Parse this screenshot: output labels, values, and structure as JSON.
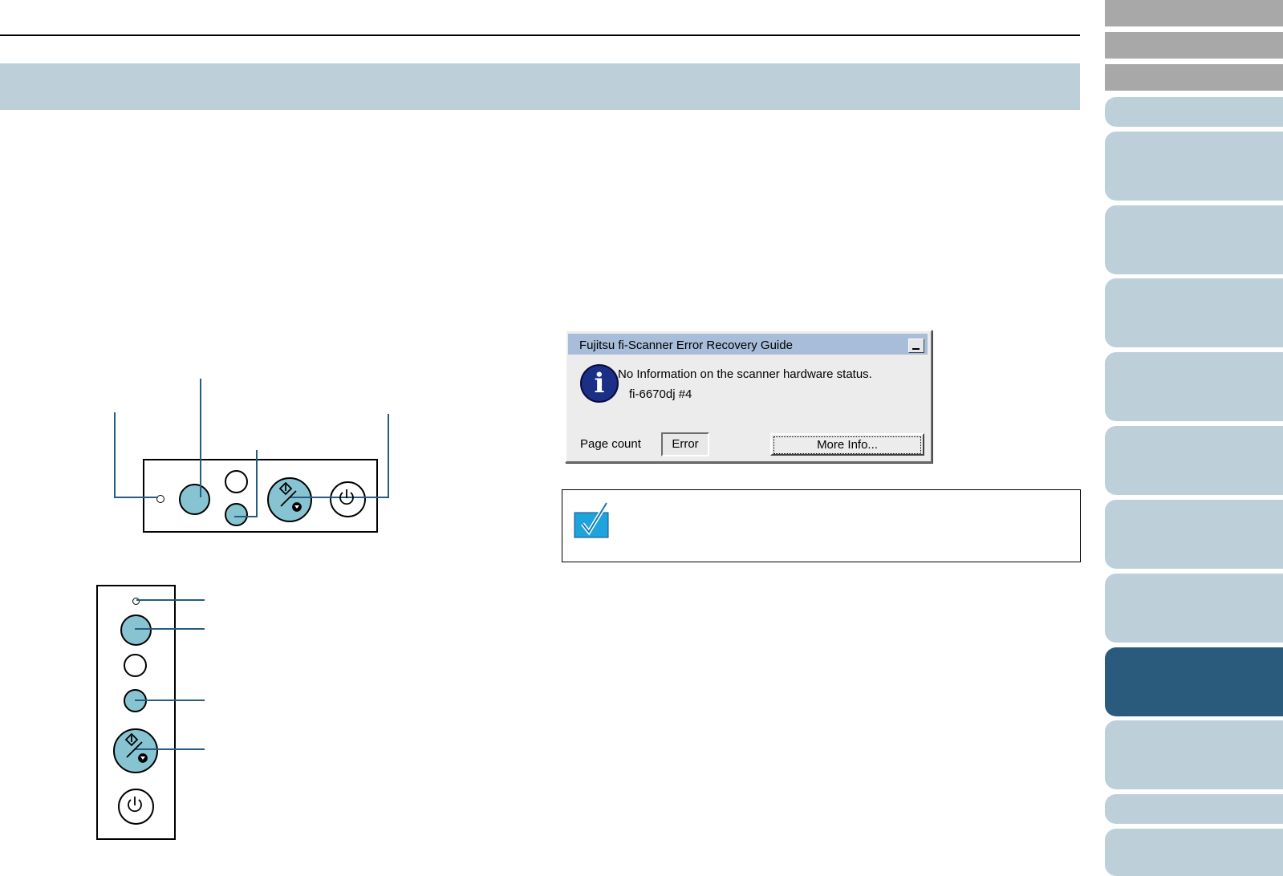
{
  "dialog": {
    "title": "Fujitsu fi-Scanner Error Recovery Guide",
    "info_icon": "info-icon",
    "message": "No Information on the scanner hardware status.",
    "device": "fi-6670dj #4",
    "page_count_label": "Page count",
    "page_count_value": "Error",
    "more_info_label": "More Info..."
  },
  "hint_icon": "checkmark-hint-icon",
  "colors": {
    "banner": "#bdd0da",
    "tab": "#bdd0da",
    "tab_active": "#2a5b7c",
    "tab_grey": "#a8a8a8",
    "button_blue": "#87c4d1",
    "callout_line": "#275b80"
  },
  "nav_tabs": {
    "count": 14,
    "active_index": 11
  }
}
